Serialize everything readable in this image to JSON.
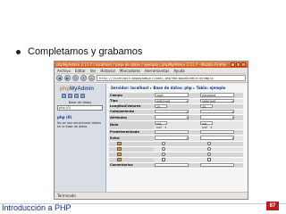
{
  "slide": {
    "bullet": "Completamos y grabamos",
    "footer": "Introducción a PHP",
    "page_number": "87"
  },
  "browser": {
    "title": "phpMyAdmin 2.11.7 / localhost / base de datos / ejemplo | phpMyAdmin 2.11.7 - Mozilla Firefox",
    "menu": [
      "Archivo",
      "Editar",
      "Ver",
      "Historial",
      "Marcadores",
      "Herramientas",
      "Ayuda"
    ],
    "url": "http://localhost/phpmyadmin/index.php?db=base&table=ejemplo",
    "status": "Terminado"
  },
  "left": {
    "logo_prefix": "php",
    "logo_suffix": "MyAdmin",
    "db_label": "Base de datos",
    "db_select": "php (0)",
    "db_name": "php (0)",
    "message": "No se han encontrado tablas en la base de datos."
  },
  "breadcrumb": {
    "server": "Servidor: localhost",
    "database": "Base de datos: php",
    "table": "Tabla: ejemplo"
  },
  "fields": {
    "rows": [
      {
        "label": "Campo",
        "v1": "login",
        "v2": "password"
      },
      {
        "label": "Tipo",
        "v1": "VARCHAR",
        "v2": "VARCHAR"
      },
      {
        "label": "Longitud/Valores",
        "v1": "20",
        "v2": "20"
      },
      {
        "label": "Cotejamiento",
        "v1": "",
        "v2": ""
      },
      {
        "label": "Atributos",
        "v1": "",
        "v2": ""
      },
      {
        "label": "Nulo",
        "v1": "not null",
        "v2": "not null"
      },
      {
        "label": "Predeterminado",
        "v1": "",
        "v2": ""
      },
      {
        "label": "Extra",
        "v1": "",
        "v2": ""
      },
      {
        "label": "",
        "v1": "",
        "v2": ""
      },
      {
        "label": "",
        "v1": "",
        "v2": ""
      },
      {
        "label": "",
        "v1": "",
        "v2": ""
      },
      {
        "label": "",
        "v1": "",
        "v2": ""
      },
      {
        "label": "Comentarios",
        "v1": "",
        "v2": ""
      }
    ]
  },
  "colors": {
    "footer_text": "#1a2c7a",
    "page_badge": "#b91d1d",
    "titlebar": "#d66a2c"
  }
}
